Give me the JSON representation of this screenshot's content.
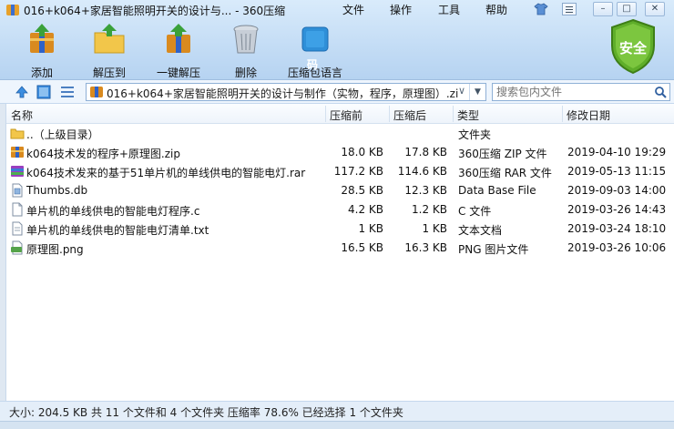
{
  "window": {
    "title": "016+k064+家居智能照明开关的设计与... - 360压缩",
    "menu": [
      "文件",
      "操作",
      "工具",
      "帮助"
    ]
  },
  "toolbar": {
    "items": [
      {
        "label": "添加",
        "icon": "add-archive-icon"
      },
      {
        "label": "解压到",
        "icon": "extract-to-icon"
      },
      {
        "label": "一键解压",
        "icon": "one-click-extract-icon"
      },
      {
        "label": "删除",
        "icon": "trash-icon"
      },
      {
        "label": "压缩包语言",
        "icon": "language-icon"
      }
    ],
    "language_glyph": "码",
    "shield_label": "安全"
  },
  "address": {
    "path": "016+k064+家居智能照明开关的设计与制作（实物，程序，原理图）.zi",
    "search_placeholder": "搜索包内文件"
  },
  "columns": [
    "名称",
    "压缩前",
    "压缩后",
    "类型",
    "修改日期"
  ],
  "files": [
    {
      "name": "..（上级目录）",
      "before": "",
      "after": "",
      "type": "文件夹",
      "date": "",
      "icon": "folder-up-icon"
    },
    {
      "name": "k064技术发的程序+原理图.zip",
      "before": "18.0 KB",
      "after": "17.8 KB",
      "type": "360压缩 ZIP 文件",
      "date": "2019-04-10 19:29",
      "icon": "archive-icon"
    },
    {
      "name": "k064技术发来的基于51单片机的单线供电的智能电灯.rar",
      "before": "117.2 KB",
      "after": "114.6 KB",
      "type": "360压缩 RAR 文件",
      "date": "2019-05-13 11:15",
      "icon": "archive-icon"
    },
    {
      "name": "Thumbs.db",
      "before": "28.5 KB",
      "after": "12.3 KB",
      "type": "Data Base File",
      "date": "2019-09-03 14:00",
      "icon": "db-file-icon"
    },
    {
      "name": "单片机的单线供电的智能电灯程序.c",
      "before": "4.2 KB",
      "after": "1.2 KB",
      "type": "C 文件",
      "date": "2019-03-26 14:43",
      "icon": "c-file-icon"
    },
    {
      "name": "单片机的单线供电的智能电灯清单.txt",
      "before": "1 KB",
      "after": "1 KB",
      "type": "文本文档",
      "date": "2019-03-24 18:10",
      "icon": "text-file-icon"
    },
    {
      "name": "原理图.png",
      "before": "16.5 KB",
      "after": "16.3 KB",
      "type": "PNG 图片文件",
      "date": "2019-03-26 10:06",
      "icon": "png-file-icon"
    }
  ],
  "status": "大小: 204.5 KB 共 11 个文件和 4 个文件夹 压缩率 78.6% 已经选择 1 个文件夹",
  "colors": {
    "accent": "#2f7fd1",
    "shield": "#5fae2a",
    "header_bg": "#c3dcf5"
  }
}
